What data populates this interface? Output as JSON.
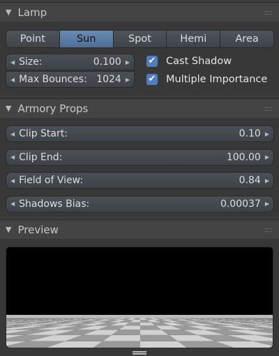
{
  "lamp": {
    "title": "Lamp",
    "types": [
      "Point",
      "Sun",
      "Spot",
      "Hemi",
      "Area"
    ],
    "active_type": "Sun",
    "size": {
      "label": "Size:",
      "value": "0.100"
    },
    "max_bounces": {
      "label": "Max Bounces:",
      "value": "1024"
    },
    "cast_shadow": {
      "label": "Cast Shadow",
      "checked": true
    },
    "multiple_importance": {
      "label": "Multiple Importance",
      "checked": true
    }
  },
  "armory": {
    "title": "Armory Props",
    "fields": [
      {
        "label": "Clip Start:",
        "value": "0.10"
      },
      {
        "label": "Clip End:",
        "value": "100.00"
      },
      {
        "label": "Field of View:",
        "value": "0.84"
      },
      {
        "label": "Shadows Bias:",
        "value": "0.00037"
      }
    ]
  },
  "preview": {
    "title": "Preview"
  }
}
